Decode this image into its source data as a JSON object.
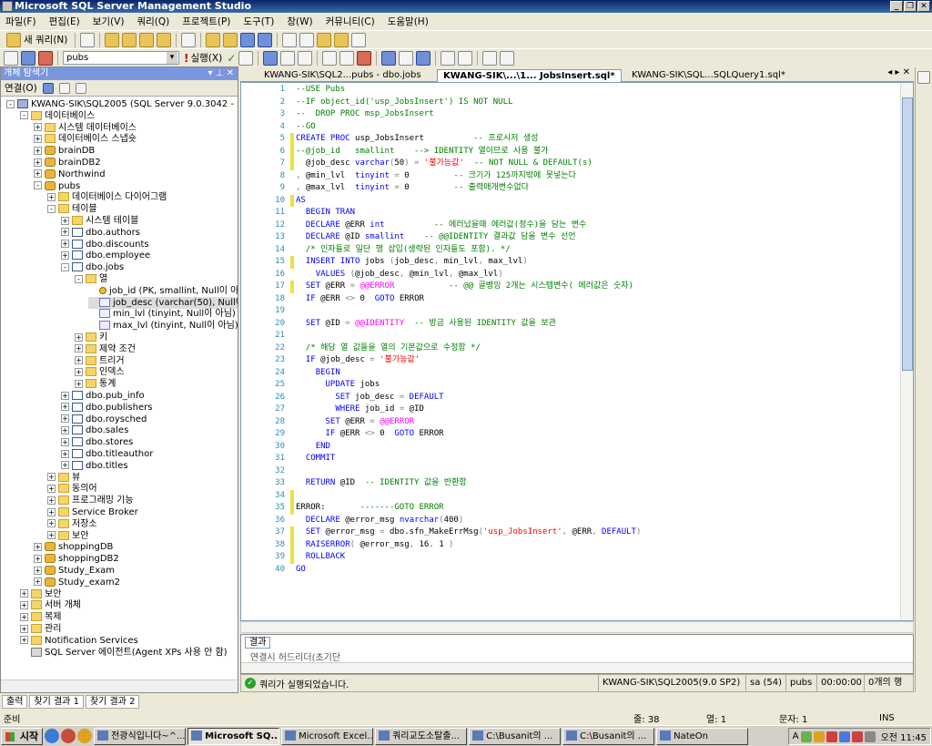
{
  "app": {
    "title": "Microsoft SQL Server Management Studio"
  },
  "menu": [
    "파일(F)",
    "편집(E)",
    "보기(V)",
    "쿼리(Q)",
    "프로젝트(P)",
    "도구(T)",
    "창(W)",
    "커뮤니티(C)",
    "도움말(H)"
  ],
  "toolbar": {
    "new_query_label": "새 쿼리(N)",
    "database_selected": "pubs",
    "execute_label": "실행(X)"
  },
  "object_explorer": {
    "title": "개체 탐색기",
    "connect_label": "연결(O)",
    "nodes": [
      {
        "label": "KWANG-SIK\\SQL2005 (SQL Server 9.0.3042 - sa)",
        "icon": "server",
        "exp": "-"
      },
      {
        "label": "데이터베이스",
        "icon": "folder",
        "exp": "-"
      },
      {
        "label": "시스템 데이터베이스",
        "icon": "folder",
        "exp": "+"
      },
      {
        "label": "데이터베이스 스냅숏",
        "icon": "folder",
        "exp": "+"
      },
      {
        "label": "brainDB",
        "icon": "db",
        "exp": "+"
      },
      {
        "label": "brainDB2",
        "icon": "db",
        "exp": "+"
      },
      {
        "label": "Northwind",
        "icon": "db",
        "exp": "+"
      },
      {
        "label": "pubs",
        "icon": "db",
        "exp": "-"
      },
      {
        "label": "데이터베이스 다이어그램",
        "icon": "folder",
        "exp": "+"
      },
      {
        "label": "테이블",
        "icon": "folder",
        "exp": "-"
      },
      {
        "label": "시스템 테이블",
        "icon": "folder",
        "exp": "+"
      },
      {
        "label": "dbo.authors",
        "icon": "table",
        "exp": "+"
      },
      {
        "label": "dbo.discounts",
        "icon": "table",
        "exp": "+"
      },
      {
        "label": "dbo.employee",
        "icon": "table",
        "exp": "+"
      },
      {
        "label": "dbo.jobs",
        "icon": "table",
        "exp": "-"
      },
      {
        "label": "열",
        "icon": "folder",
        "exp": "-"
      },
      {
        "label": "job_id (PK, smallint, Null이 아님)",
        "icon": "key",
        "exp": ""
      },
      {
        "label": "job_desc (varchar(50), Null이 아님)",
        "icon": "col",
        "exp": "",
        "selected": true
      },
      {
        "label": "min_lvl (tinyint, Null이 아님)",
        "icon": "col",
        "exp": ""
      },
      {
        "label": "max_lvl (tinyint, Null이 아님)",
        "icon": "col",
        "exp": ""
      },
      {
        "label": "키",
        "icon": "folder",
        "exp": "+"
      },
      {
        "label": "제약 조건",
        "icon": "folder",
        "exp": "+"
      },
      {
        "label": "트리거",
        "icon": "folder",
        "exp": "+"
      },
      {
        "label": "인덱스",
        "icon": "folder",
        "exp": "+"
      },
      {
        "label": "통계",
        "icon": "folder",
        "exp": "+"
      },
      {
        "label": "dbo.pub_info",
        "icon": "table",
        "exp": "+"
      },
      {
        "label": "dbo.publishers",
        "icon": "table",
        "exp": "+"
      },
      {
        "label": "dbo.roysched",
        "icon": "table",
        "exp": "+"
      },
      {
        "label": "dbo.sales",
        "icon": "table",
        "exp": "+"
      },
      {
        "label": "dbo.stores",
        "icon": "table",
        "exp": "+"
      },
      {
        "label": "dbo.titleauthor",
        "icon": "table",
        "exp": "+"
      },
      {
        "label": "dbo.titles",
        "icon": "table",
        "exp": "+"
      },
      {
        "label": "뷰",
        "icon": "folder",
        "exp": "+"
      },
      {
        "label": "동의어",
        "icon": "folder",
        "exp": "+"
      },
      {
        "label": "프로그래밍 기능",
        "icon": "folder",
        "exp": "+"
      },
      {
        "label": "Service Broker",
        "icon": "folder",
        "exp": "+"
      },
      {
        "label": "저장소",
        "icon": "folder",
        "exp": "+"
      },
      {
        "label": "보안",
        "icon": "folder",
        "exp": "+"
      },
      {
        "label": "shoppingDB",
        "icon": "db",
        "exp": "+"
      },
      {
        "label": "shoppingDB2",
        "icon": "db",
        "exp": "+"
      },
      {
        "label": "Study_Exam",
        "icon": "db",
        "exp": "+"
      },
      {
        "label": "Study_exam2",
        "icon": "db",
        "exp": "+"
      },
      {
        "label": "보안",
        "icon": "folder",
        "exp": "+"
      },
      {
        "label": "서버 개체",
        "icon": "folder",
        "exp": "+"
      },
      {
        "label": "복제",
        "icon": "folder",
        "exp": "+"
      },
      {
        "label": "관리",
        "icon": "folder",
        "exp": "+"
      },
      {
        "label": "Notification Services",
        "icon": "folder",
        "exp": "+"
      },
      {
        "label": "SQL Server 에이전트(Agent XPs 사용 안 함)",
        "icon": "agent",
        "exp": ""
      }
    ]
  },
  "tabs": [
    {
      "label": "KWANG-SIK\\SQL2...pubs - dbo.jobs",
      "active": false
    },
    {
      "label": "KWANG-SIK\\...\\1... JobsInsert.sql*",
      "active": true
    },
    {
      "label": "KWANG-SIK\\SQL...SQLQuery1.sql*",
      "active": false
    }
  ],
  "editor": {
    "lines": [
      [
        [
          "cm",
          "--USE Pubs"
        ]
      ],
      [
        [
          "cm",
          "--IF object_id('usp_JobsInsert') IS NOT NULL"
        ]
      ],
      [
        [
          "cm",
          "--  DROP PROC msp_JobsInsert"
        ]
      ],
      [
        [
          "cm",
          "--GO"
        ]
      ],
      [
        [
          "kw",
          "CREATE PROC "
        ],
        [
          "",
          "usp_JobsInsert          "
        ],
        [
          "cm",
          "-- 프로시저 생성"
        ]
      ],
      [
        [
          "cm",
          "--@job_id   smallint    --> IDENTITY 열이므로 사용 불가"
        ]
      ],
      [
        [
          "",
          "  @job_desc "
        ],
        [
          "kw",
          "varchar"
        ],
        [
          "gy",
          "("
        ],
        [
          "",
          "50"
        ],
        [
          "gy",
          ") = "
        ],
        [
          "st",
          "'불가능값'"
        ],
        [
          "",
          "  "
        ],
        [
          "cm",
          "-- NOT NULL & DEFAULT(s)"
        ]
      ],
      [
        [
          "gy",
          ", "
        ],
        [
          "",
          "@min_lvl  "
        ],
        [
          "kw",
          "tinyint"
        ],
        [
          "gy",
          " = "
        ],
        [
          "",
          "0         "
        ],
        [
          "cm",
          "-- 크기가 125까지밖에 못넣는다"
        ]
      ],
      [
        [
          "gy",
          ", "
        ],
        [
          "",
          "@max_lvl  "
        ],
        [
          "kw",
          "tinyint"
        ],
        [
          "gy",
          " = "
        ],
        [
          "",
          "0         "
        ],
        [
          "cm",
          "-- 출력매개변수없다"
        ]
      ],
      [
        [
          "kw",
          "AS"
        ]
      ],
      [
        [
          "",
          "  "
        ],
        [
          "kw",
          "BEGIN TRAN"
        ]
      ],
      [
        [
          "",
          "  "
        ],
        [
          "kw",
          "DECLARE "
        ],
        [
          "",
          "@ERR "
        ],
        [
          "kw",
          "int          "
        ],
        [
          "cm",
          "-- 에러났을때 에러값(정수)을 담는 변수"
        ]
      ],
      [
        [
          "",
          "  "
        ],
        [
          "kw",
          "DECLARE "
        ],
        [
          "",
          "@ID "
        ],
        [
          "kw",
          "smallint    "
        ],
        [
          "cm",
          "-- @@IDENTITY 결과값 담을 변수 선언"
        ]
      ],
      [
        [
          "",
          "  "
        ],
        [
          "cm",
          "/* 인자들로 일단 행 삽입(생략된 인자들도 포함). */"
        ]
      ],
      [
        [
          "",
          "  "
        ],
        [
          "kw",
          "INSERT INTO "
        ],
        [
          "",
          "jobs "
        ],
        [
          "gy",
          "("
        ],
        [
          "",
          "job_desc"
        ],
        [
          "gy",
          ", "
        ],
        [
          "",
          "min_lvl"
        ],
        [
          "gy",
          ", "
        ],
        [
          "",
          "max_lvl"
        ],
        [
          "gy",
          ")"
        ]
      ],
      [
        [
          "",
          "    "
        ],
        [
          "kw",
          "VALUES "
        ],
        [
          "gy",
          "("
        ],
        [
          "",
          "@job_desc"
        ],
        [
          "gy",
          ", "
        ],
        [
          "",
          "@min_lvl"
        ],
        [
          "gy",
          ", "
        ],
        [
          "",
          "@max_lvl"
        ],
        [
          "gy",
          ")"
        ]
      ],
      [
        [
          "",
          "  "
        ],
        [
          "kw",
          "SET "
        ],
        [
          "",
          "@ERR "
        ],
        [
          "gy",
          "= "
        ],
        [
          "fn",
          "@@ERROR           "
        ],
        [
          "cm",
          "-- @@ 골뱅잉 2개는 시스템변수( 에러값은 숫자)"
        ]
      ],
      [
        [
          "",
          "  "
        ],
        [
          "kw",
          "IF "
        ],
        [
          "",
          "@ERR "
        ],
        [
          "gy",
          "<> "
        ],
        [
          "",
          "0  "
        ],
        [
          "kw",
          "GOTO "
        ],
        [
          "",
          "ERROR"
        ]
      ],
      [
        [
          "",
          ""
        ]
      ],
      [
        [
          "",
          "  "
        ],
        [
          "kw",
          "SET "
        ],
        [
          "",
          "@ID "
        ],
        [
          "gy",
          "= "
        ],
        [
          "fn",
          "@@IDENTITY"
        ],
        [
          "",
          "  "
        ],
        [
          "cm",
          "-- 방금 사용된 IDENTITY 값을 보관"
        ]
      ],
      [
        [
          "",
          ""
        ]
      ],
      [
        [
          "",
          "  "
        ],
        [
          "cm",
          "/* 해당 열 값들을 열의 기본값으로 수정함 */"
        ]
      ],
      [
        [
          "",
          "  "
        ],
        [
          "kw",
          "IF "
        ],
        [
          "",
          "@job_desc "
        ],
        [
          "gy",
          "= "
        ],
        [
          "st",
          "'불가능값'"
        ]
      ],
      [
        [
          "",
          "    "
        ],
        [
          "kw",
          "BEGIN"
        ]
      ],
      [
        [
          "",
          "      "
        ],
        [
          "kw",
          "UPDATE "
        ],
        [
          "",
          "jobs"
        ]
      ],
      [
        [
          "",
          "        "
        ],
        [
          "kw",
          "SET "
        ],
        [
          "",
          "job_desc "
        ],
        [
          "gy",
          "= "
        ],
        [
          "kw",
          "DEFAULT"
        ]
      ],
      [
        [
          "",
          "        "
        ],
        [
          "kw",
          "WHERE "
        ],
        [
          "",
          "job_id "
        ],
        [
          "gy",
          "= "
        ],
        [
          "",
          "@ID"
        ]
      ],
      [
        [
          "",
          "      "
        ],
        [
          "kw",
          "SET "
        ],
        [
          "",
          "@ERR "
        ],
        [
          "gy",
          "= "
        ],
        [
          "fn",
          "@@ERROR"
        ]
      ],
      [
        [
          "",
          "      "
        ],
        [
          "kw",
          "IF "
        ],
        [
          "",
          "@ERR "
        ],
        [
          "gy",
          "<> "
        ],
        [
          "",
          "0  "
        ],
        [
          "kw",
          "GOTO "
        ],
        [
          "",
          "ERROR"
        ]
      ],
      [
        [
          "",
          "    "
        ],
        [
          "kw",
          "END"
        ]
      ],
      [
        [
          "",
          "  "
        ],
        [
          "kw",
          "COMMIT"
        ]
      ],
      [
        [
          "",
          ""
        ]
      ],
      [
        [
          "",
          "  "
        ],
        [
          "kw",
          "RETURN "
        ],
        [
          "",
          "@ID  "
        ],
        [
          "cm",
          "-- IDENTITY 값을 반환함"
        ]
      ],
      [
        [
          "",
          ""
        ]
      ],
      [
        [
          "",
          "ERROR:       "
        ],
        [
          "cm",
          "-------GOTO ERROR"
        ]
      ],
      [
        [
          "",
          "  "
        ],
        [
          "kw",
          "DECLARE "
        ],
        [
          "",
          "@error_msg "
        ],
        [
          "kw",
          "nvarchar"
        ],
        [
          "gy",
          "("
        ],
        [
          "",
          "400"
        ],
        [
          "gy",
          ")"
        ]
      ],
      [
        [
          "",
          "  "
        ],
        [
          "kw",
          "SET "
        ],
        [
          "",
          "@error_msg "
        ],
        [
          "gy",
          "= "
        ],
        [
          "",
          "dbo.sfn_MakeErrMsg"
        ],
        [
          "gy",
          "("
        ],
        [
          "st",
          "'usp_JobsInsert'"
        ],
        [
          "gy",
          ", "
        ],
        [
          "",
          "@ERR"
        ],
        [
          "gy",
          ", "
        ],
        [
          "kw",
          "DEFAULT"
        ],
        [
          "gy",
          ")"
        ]
      ],
      [
        [
          "",
          "  "
        ],
        [
          "kw",
          "RAISERROR"
        ],
        [
          "gy",
          "( "
        ],
        [
          "",
          "@error_msg"
        ],
        [
          "gy",
          ", "
        ],
        [
          "",
          "16"
        ],
        [
          "gy",
          ", "
        ],
        [
          "",
          "1 "
        ],
        [
          "gy",
          ")"
        ]
      ],
      [
        [
          "",
          "  "
        ],
        [
          "kw",
          "ROLLBACK"
        ]
      ],
      [
        [
          "kw",
          "GO"
        ]
      ]
    ],
    "changed_lines": [
      4,
      5,
      6,
      9,
      14,
      16,
      33,
      34,
      36,
      37,
      38
    ]
  },
  "results": {
    "tab_label": "결과",
    "peek_text": "연결시 허드리더(초기단"
  },
  "query_status": {
    "message": "쿼리가 실행되었습니다.",
    "server": "KWANG-SIK\\SQL2005(9.0 SP2)",
    "user": "sa (54)",
    "database": "pubs",
    "elapsed": "00:00:00",
    "rows": "0개의 행"
  },
  "dock_tabs": [
    "출력",
    "찾기 결과 1",
    "찾기 결과 2"
  ],
  "statusbar": {
    "ready": "준비",
    "line": "줄: 38",
    "column": "열: 1",
    "char": "문자: 1",
    "mode": "INS"
  },
  "taskbar": {
    "start": "시작",
    "tasks": [
      {
        "label": "전광식입니다~^...",
        "active": false
      },
      {
        "label": "Microsoft SQ...",
        "active": true
      },
      {
        "label": "Microsoft Excel...",
        "active": false
      },
      {
        "label": "쿼리교도소탈출...",
        "active": false
      },
      {
        "label": "C:\\Busanit의 ...",
        "active": false
      },
      {
        "label": "C:\\Busanit의 ...",
        "active": false
      },
      {
        "label": "NateOn",
        "active": false
      }
    ],
    "ime": "A",
    "clock": "오전 11:45"
  }
}
